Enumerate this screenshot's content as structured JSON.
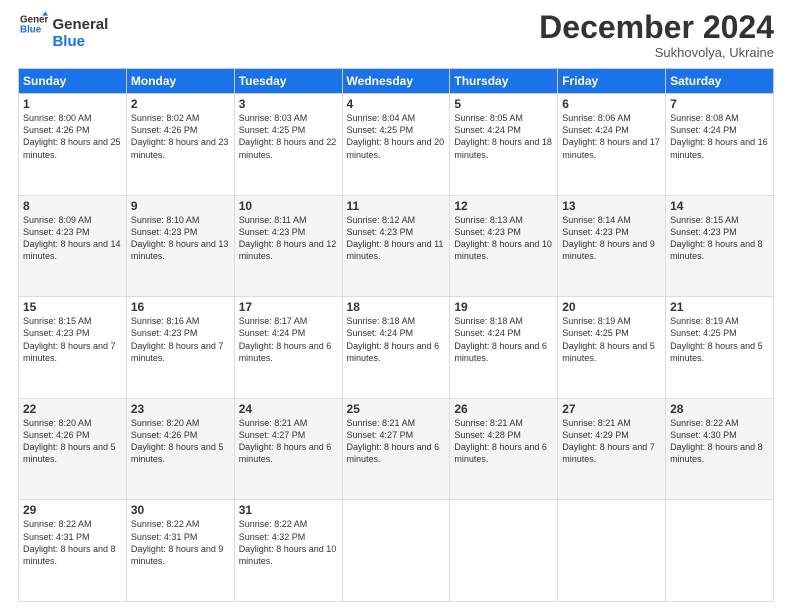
{
  "logo": {
    "line1": "General",
    "line2": "Blue"
  },
  "title": "December 2024",
  "subtitle": "Sukhovolya, Ukraine",
  "days_header": [
    "Sunday",
    "Monday",
    "Tuesday",
    "Wednesday",
    "Thursday",
    "Friday",
    "Saturday"
  ],
  "weeks": [
    [
      {
        "day": "1",
        "sunrise": "8:00 AM",
        "sunset": "4:26 PM",
        "daylight": "8 hours and 25 minutes."
      },
      {
        "day": "2",
        "sunrise": "8:02 AM",
        "sunset": "4:26 PM",
        "daylight": "8 hours and 23 minutes."
      },
      {
        "day": "3",
        "sunrise": "8:03 AM",
        "sunset": "4:25 PM",
        "daylight": "8 hours and 22 minutes."
      },
      {
        "day": "4",
        "sunrise": "8:04 AM",
        "sunset": "4:25 PM",
        "daylight": "8 hours and 20 minutes."
      },
      {
        "day": "5",
        "sunrise": "8:05 AM",
        "sunset": "4:24 PM",
        "daylight": "8 hours and 18 minutes."
      },
      {
        "day": "6",
        "sunrise": "8:06 AM",
        "sunset": "4:24 PM",
        "daylight": "8 hours and 17 minutes."
      },
      {
        "day": "7",
        "sunrise": "8:08 AM",
        "sunset": "4:24 PM",
        "daylight": "8 hours and 16 minutes."
      }
    ],
    [
      {
        "day": "8",
        "sunrise": "8:09 AM",
        "sunset": "4:23 PM",
        "daylight": "8 hours and 14 minutes."
      },
      {
        "day": "9",
        "sunrise": "8:10 AM",
        "sunset": "4:23 PM",
        "daylight": "8 hours and 13 minutes."
      },
      {
        "day": "10",
        "sunrise": "8:11 AM",
        "sunset": "4:23 PM",
        "daylight": "8 hours and 12 minutes."
      },
      {
        "day": "11",
        "sunrise": "8:12 AM",
        "sunset": "4:23 PM",
        "daylight": "8 hours and 11 minutes."
      },
      {
        "day": "12",
        "sunrise": "8:13 AM",
        "sunset": "4:23 PM",
        "daylight": "8 hours and 10 minutes."
      },
      {
        "day": "13",
        "sunrise": "8:14 AM",
        "sunset": "4:23 PM",
        "daylight": "8 hours and 9 minutes."
      },
      {
        "day": "14",
        "sunrise": "8:15 AM",
        "sunset": "4:23 PM",
        "daylight": "8 hours and 8 minutes."
      }
    ],
    [
      {
        "day": "15",
        "sunrise": "8:15 AM",
        "sunset": "4:23 PM",
        "daylight": "8 hours and 7 minutes."
      },
      {
        "day": "16",
        "sunrise": "8:16 AM",
        "sunset": "4:23 PM",
        "daylight": "8 hours and 7 minutes."
      },
      {
        "day": "17",
        "sunrise": "8:17 AM",
        "sunset": "4:24 PM",
        "daylight": "8 hours and 6 minutes."
      },
      {
        "day": "18",
        "sunrise": "8:18 AM",
        "sunset": "4:24 PM",
        "daylight": "8 hours and 6 minutes."
      },
      {
        "day": "19",
        "sunrise": "8:18 AM",
        "sunset": "4:24 PM",
        "daylight": "8 hours and 6 minutes."
      },
      {
        "day": "20",
        "sunrise": "8:19 AM",
        "sunset": "4:25 PM",
        "daylight": "8 hours and 5 minutes."
      },
      {
        "day": "21",
        "sunrise": "8:19 AM",
        "sunset": "4:25 PM",
        "daylight": "8 hours and 5 minutes."
      }
    ],
    [
      {
        "day": "22",
        "sunrise": "8:20 AM",
        "sunset": "4:26 PM",
        "daylight": "8 hours and 5 minutes."
      },
      {
        "day": "23",
        "sunrise": "8:20 AM",
        "sunset": "4:26 PM",
        "daylight": "8 hours and 5 minutes."
      },
      {
        "day": "24",
        "sunrise": "8:21 AM",
        "sunset": "4:27 PM",
        "daylight": "8 hours and 6 minutes."
      },
      {
        "day": "25",
        "sunrise": "8:21 AM",
        "sunset": "4:27 PM",
        "daylight": "8 hours and 6 minutes."
      },
      {
        "day": "26",
        "sunrise": "8:21 AM",
        "sunset": "4:28 PM",
        "daylight": "8 hours and 6 minutes."
      },
      {
        "day": "27",
        "sunrise": "8:21 AM",
        "sunset": "4:29 PM",
        "daylight": "8 hours and 7 minutes."
      },
      {
        "day": "28",
        "sunrise": "8:22 AM",
        "sunset": "4:30 PM",
        "daylight": "8 hours and 8 minutes."
      }
    ],
    [
      {
        "day": "29",
        "sunrise": "8:22 AM",
        "sunset": "4:31 PM",
        "daylight": "8 hours and 8 minutes."
      },
      {
        "day": "30",
        "sunrise": "8:22 AM",
        "sunset": "4:31 PM",
        "daylight": "8 hours and 9 minutes."
      },
      {
        "day": "31",
        "sunrise": "8:22 AM",
        "sunset": "4:32 PM",
        "daylight": "8 hours and 10 minutes."
      },
      null,
      null,
      null,
      null
    ]
  ],
  "labels": {
    "sunrise": "Sunrise:",
    "sunset": "Sunset:",
    "daylight": "Daylight:"
  }
}
